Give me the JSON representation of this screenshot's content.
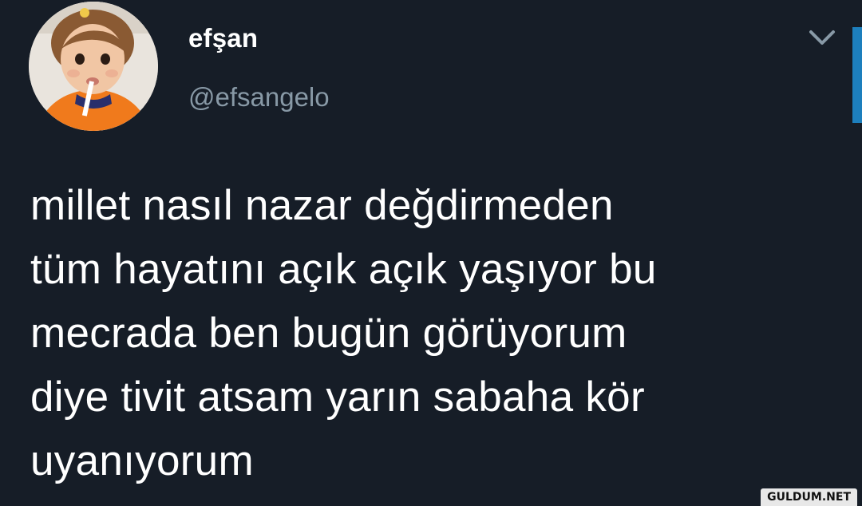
{
  "user": {
    "display_name": "efşan",
    "handle": "@efsangelo",
    "avatar_icon": "child-avatar-icon"
  },
  "menu": {
    "icon": "chevron-down-icon"
  },
  "tweet": {
    "lines": [
      "millet nasıl nazar değdirmeden",
      "tüm hayatını açık açık yaşıyor bu",
      "mecrada ben bugün görüyorum",
      "diye tivit atsam yarın sabaha kör",
      "uyanıyorum"
    ]
  },
  "watermark": {
    "text": "GULDUM.NET"
  },
  "colors": {
    "background": "#161d27",
    "text": "#ffffff",
    "muted": "#8899a6",
    "accent": "#1d7fbd"
  }
}
